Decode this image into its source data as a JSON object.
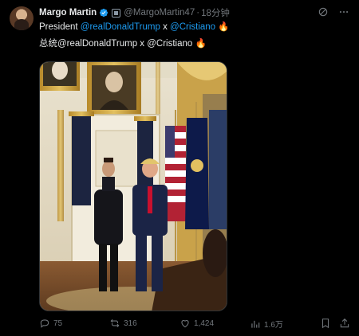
{
  "author": {
    "name": "Margo Martin",
    "handle": "@MargoMartin47",
    "separator": "·",
    "time": "18分钟"
  },
  "text": {
    "line1_prefix": "President ",
    "line1_mention1": "@realDonaldTrump",
    "line1_middle": " x ",
    "line1_mention2": "@Cristiano",
    "line1_emoji": " 🔥",
    "line2": "总统@realDonaldTrump x @Cristiano 🔥"
  },
  "actions": {
    "replies": "75",
    "reposts": "316",
    "likes": "1,424",
    "views": "1.6万"
  },
  "icons": {
    "verified": "verified-badge-icon",
    "affiliate": "affiliate-badge-icon",
    "grok": "grok-icon",
    "more": "more-icon",
    "reply": "reply-icon",
    "repost": "repost-icon",
    "like": "like-icon",
    "views": "views-icon",
    "bookmark": "bookmark-icon",
    "share": "share-icon"
  },
  "colors": {
    "background": "#000000",
    "text": "#e7e9ea",
    "muted": "#71767b",
    "accent": "#1d9bf0",
    "border": "#2f3336"
  }
}
